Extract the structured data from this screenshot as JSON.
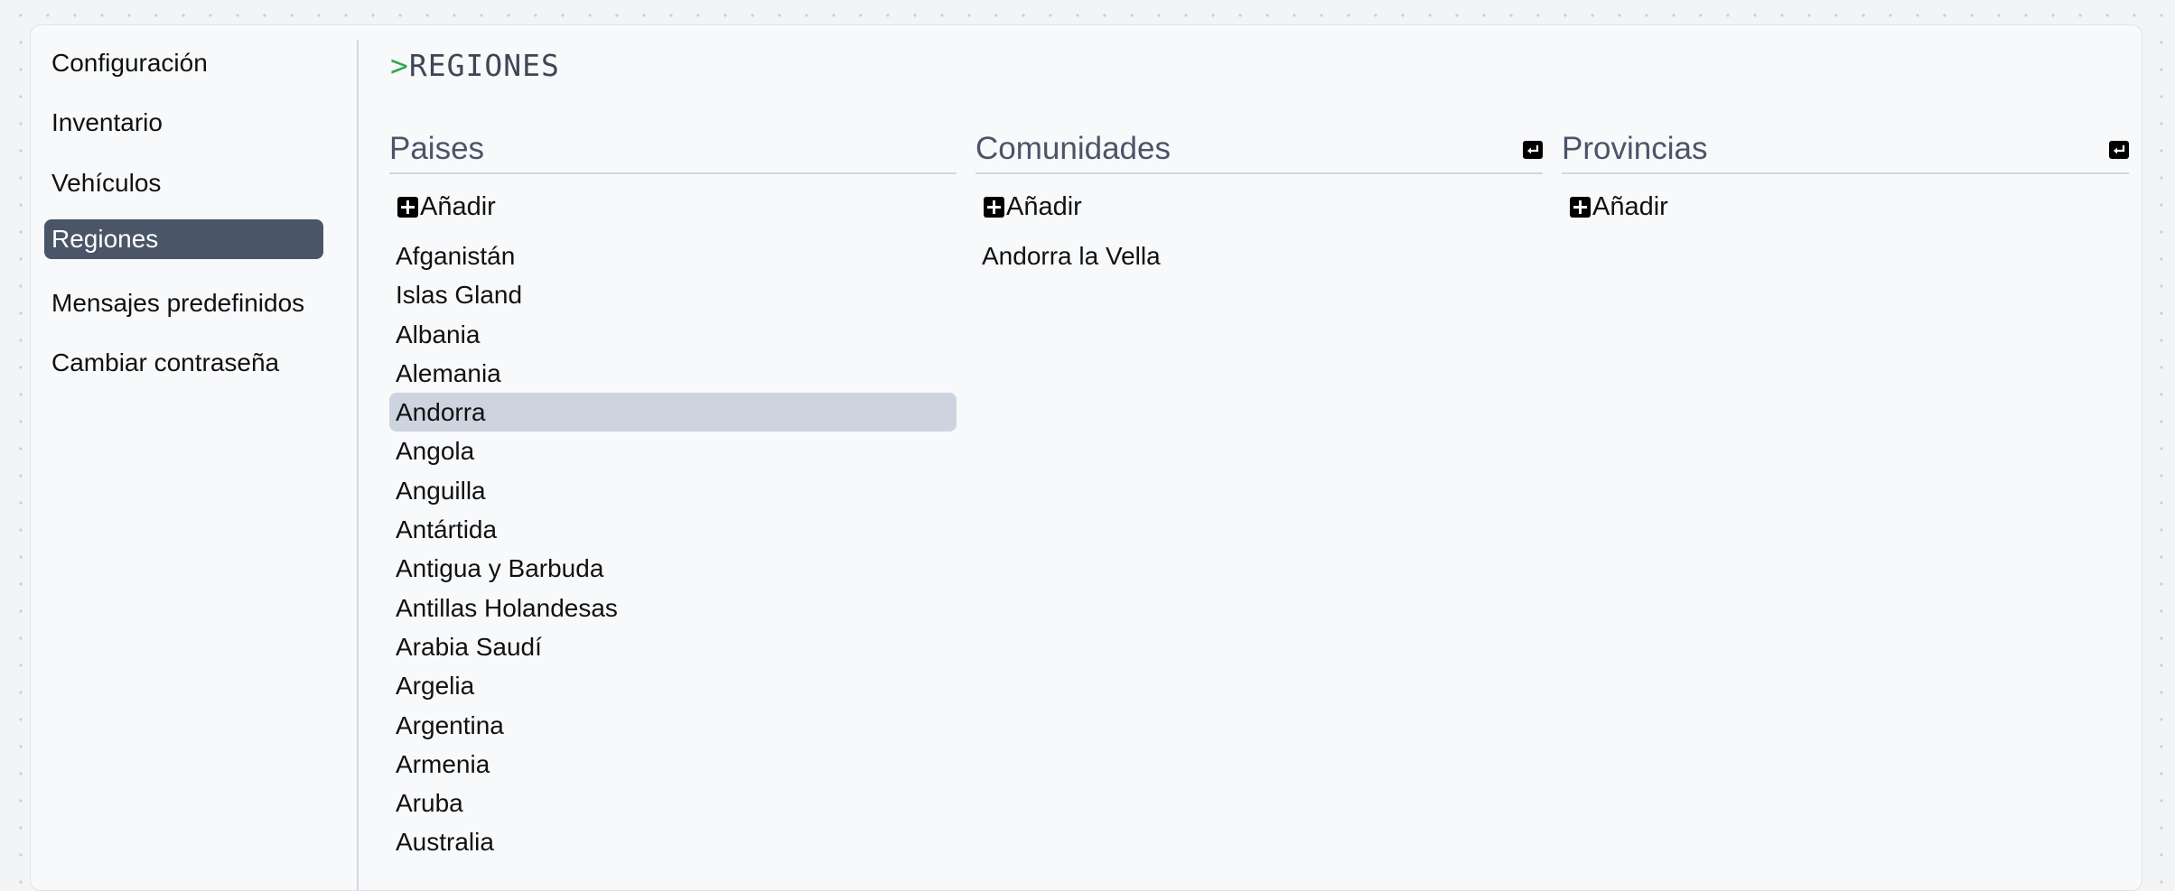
{
  "sidebar": {
    "items": [
      {
        "label": "Configuración",
        "active": false
      },
      {
        "label": "Inventario",
        "active": false
      },
      {
        "label": "Vehículos",
        "active": false
      },
      {
        "label": "Regiones",
        "active": true
      },
      {
        "label": "Mensajes predefinidos",
        "active": false
      },
      {
        "label": "Cambiar contraseña",
        "active": false
      }
    ]
  },
  "page": {
    "prompt": ">",
    "title": "REGIONES"
  },
  "columns": {
    "paises": {
      "title": "Paises",
      "add_label": "Añadir",
      "selected": "Andorra",
      "items": [
        "Afganistán",
        "Islas Gland",
        "Albania",
        "Alemania",
        "Andorra",
        "Angola",
        "Anguilla",
        "Antártida",
        "Antigua y Barbuda",
        "Antillas Holandesas",
        "Arabia Saudí",
        "Argelia",
        "Argentina",
        "Armenia",
        "Aruba",
        "Australia"
      ]
    },
    "comunidades": {
      "title": "Comunidades",
      "add_label": "Añadir",
      "back_icon": "return-arrow-icon",
      "items": [
        "Andorra la Vella"
      ]
    },
    "provincias": {
      "title": "Provincias",
      "add_label": "Añadir",
      "back_icon": "return-arrow-icon",
      "items": []
    }
  },
  "colors": {
    "active_nav": "#4a5568",
    "selected_row": "#cdd4df",
    "prompt": "#2fa84f",
    "heading": "#4a5568"
  }
}
